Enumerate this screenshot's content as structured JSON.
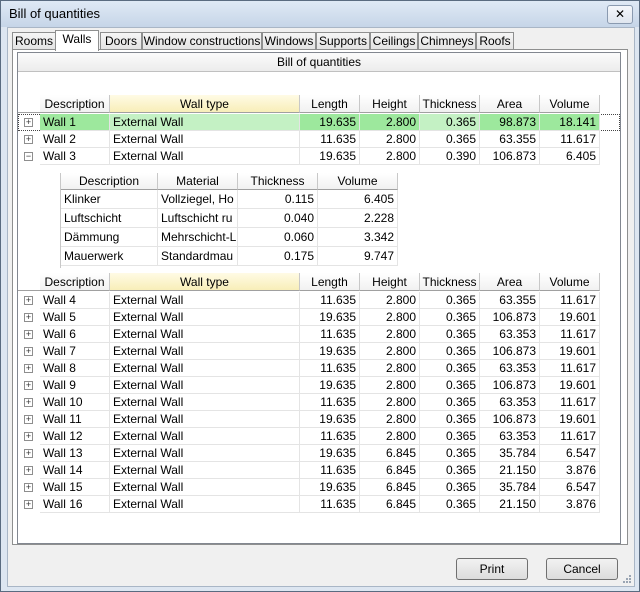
{
  "window": {
    "title": "Bill of quantities",
    "close_label": "✕"
  },
  "tabs": [
    {
      "label": "Rooms"
    },
    {
      "label": "Walls"
    },
    {
      "label": "Doors"
    },
    {
      "label": "Window constructions"
    },
    {
      "label": "Windows"
    },
    {
      "label": "Supports"
    },
    {
      "label": "Ceilings"
    },
    {
      "label": "Chimneys"
    },
    {
      "label": "Roofs"
    }
  ],
  "grid": {
    "title": "Bill of quantities",
    "columns": [
      "Description",
      "Wall type",
      "Length",
      "Height",
      "Thickness",
      "Area",
      "Volume"
    ],
    "rows_top": [
      {
        "description": "Wall 1",
        "wall_type": "External Wall",
        "length": "19.635",
        "height": "2.800",
        "thickness": "0.365",
        "area": "98.873",
        "volume": "18.141",
        "expander": "+"
      },
      {
        "description": "Wall 2",
        "wall_type": "External Wall",
        "length": "11.635",
        "height": "2.800",
        "thickness": "0.365",
        "area": "63.355",
        "volume": "11.617",
        "expander": "+"
      },
      {
        "description": "Wall 3",
        "wall_type": "External Wall",
        "length": "19.635",
        "height": "2.800",
        "thickness": "0.390",
        "area": "106.873",
        "volume": "6.405",
        "expander": "−"
      }
    ],
    "detail": {
      "columns": [
        "Description",
        "Material",
        "Thickness",
        "Volume"
      ],
      "rows": [
        {
          "description": "Klinker",
          "material": "Vollziegel, Ho",
          "thickness": "0.115",
          "volume": "6.405"
        },
        {
          "description": "Luftschicht",
          "material": "Luftschicht ru",
          "thickness": "0.040",
          "volume": "2.228"
        },
        {
          "description": "Dämmung",
          "material": "Mehrschicht-L",
          "thickness": "0.060",
          "volume": "3.342"
        },
        {
          "description": "Mauerwerk",
          "material": "Standardmau",
          "thickness": "0.175",
          "volume": "9.747"
        }
      ]
    },
    "rows_bottom": [
      {
        "description": "Wall 4",
        "wall_type": "External Wall",
        "length": "11.635",
        "height": "2.800",
        "thickness": "0.365",
        "area": "63.355",
        "volume": "11.617",
        "expander": "+"
      },
      {
        "description": "Wall 5",
        "wall_type": "External Wall",
        "length": "19.635",
        "height": "2.800",
        "thickness": "0.365",
        "area": "106.873",
        "volume": "19.601",
        "expander": "+"
      },
      {
        "description": "Wall 6",
        "wall_type": "External Wall",
        "length": "11.635",
        "height": "2.800",
        "thickness": "0.365",
        "area": "63.353",
        "volume": "11.617",
        "expander": "+"
      },
      {
        "description": "Wall 7",
        "wall_type": "External Wall",
        "length": "19.635",
        "height": "2.800",
        "thickness": "0.365",
        "area": "106.873",
        "volume": "19.601",
        "expander": "+"
      },
      {
        "description": "Wall 8",
        "wall_type": "External Wall",
        "length": "11.635",
        "height": "2.800",
        "thickness": "0.365",
        "area": "63.353",
        "volume": "11.617",
        "expander": "+"
      },
      {
        "description": "Wall 9",
        "wall_type": "External Wall",
        "length": "19.635",
        "height": "2.800",
        "thickness": "0.365",
        "area": "106.873",
        "volume": "19.601",
        "expander": "+"
      },
      {
        "description": "Wall 10",
        "wall_type": "External Wall",
        "length": "11.635",
        "height": "2.800",
        "thickness": "0.365",
        "area": "63.353",
        "volume": "11.617",
        "expander": "+"
      },
      {
        "description": "Wall 11",
        "wall_type": "External Wall",
        "length": "19.635",
        "height": "2.800",
        "thickness": "0.365",
        "area": "106.873",
        "volume": "19.601",
        "expander": "+"
      },
      {
        "description": "Wall 12",
        "wall_type": "External Wall",
        "length": "11.635",
        "height": "2.800",
        "thickness": "0.365",
        "area": "63.353",
        "volume": "11.617",
        "expander": "+"
      },
      {
        "description": "Wall 13",
        "wall_type": "External Wall",
        "length": "19.635",
        "height": "6.845",
        "thickness": "0.365",
        "area": "35.784",
        "volume": "6.547",
        "expander": "+"
      },
      {
        "description": "Wall 14",
        "wall_type": "External Wall",
        "length": "11.635",
        "height": "6.845",
        "thickness": "0.365",
        "area": "21.150",
        "volume": "3.876",
        "expander": "+"
      },
      {
        "description": "Wall 15",
        "wall_type": "External Wall",
        "length": "19.635",
        "height": "6.845",
        "thickness": "0.365",
        "area": "35.784",
        "volume": "6.547",
        "expander": "+"
      },
      {
        "description": "Wall 16",
        "wall_type": "External Wall",
        "length": "11.635",
        "height": "6.845",
        "thickness": "0.365",
        "area": "21.150",
        "volume": "3.876",
        "expander": "+"
      }
    ]
  },
  "buttons": {
    "print": "Print",
    "cancel": "Cancel"
  },
  "colors": {
    "selected_row": "#9de89d",
    "selected_row_light": "#c4f1c4",
    "header_highlight": "#f8eeb8"
  }
}
